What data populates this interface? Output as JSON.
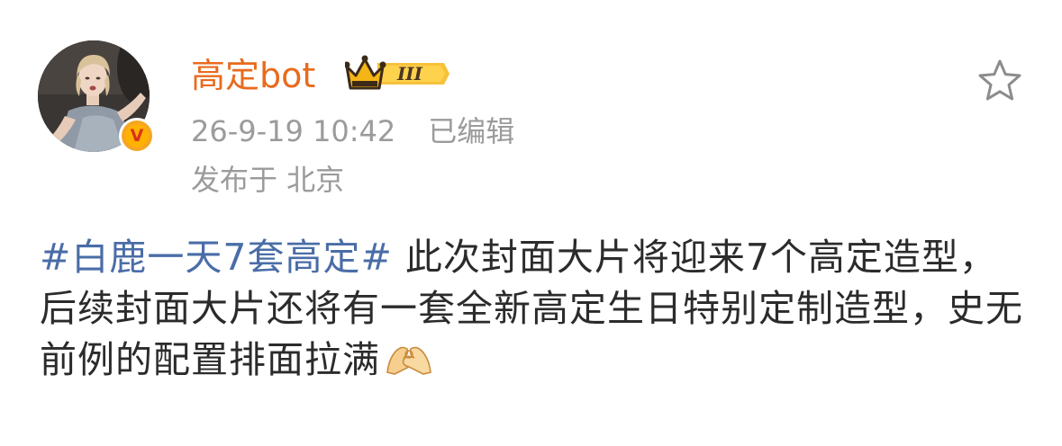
{
  "post": {
    "username": "高定bot",
    "timestamp": "26-9-19 10:42",
    "edited_label": "已编辑",
    "location": "发布于 北京",
    "hashtag": "#白鹿一天7套高定#",
    "body_text": " 此次封面大片将迎来7个高定造型，后续封面大片还将有一套全新高定生日特别定制造型，史无前例的配置排面拉满",
    "member_level": "III",
    "verified_mark": "V"
  },
  "icons": {
    "favorite": "star-outline-icon",
    "member": "crown-icon",
    "verified": "verified-v-icon",
    "emoji": "ok-hands-emoji-icon"
  },
  "colors": {
    "username": "#e86b1e",
    "hashtag": "#4a6da7",
    "meta": "#9b9b9b",
    "body": "#2b2b2b",
    "verified_badge": "#f5a623"
  }
}
